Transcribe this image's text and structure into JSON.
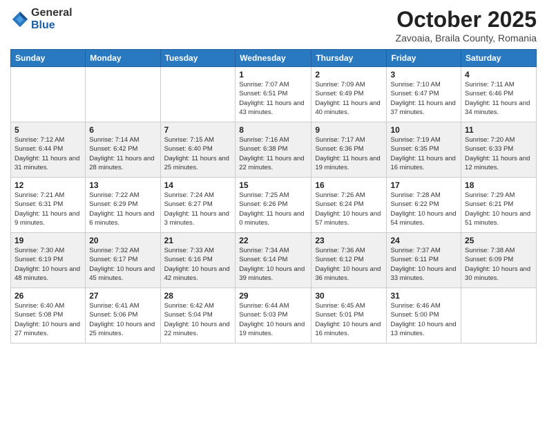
{
  "logo": {
    "general": "General",
    "blue": "Blue"
  },
  "title": "October 2025",
  "subtitle": "Zavoaia, Braila County, Romania",
  "days_of_week": [
    "Sunday",
    "Monday",
    "Tuesday",
    "Wednesday",
    "Thursday",
    "Friday",
    "Saturday"
  ],
  "weeks": [
    [
      {
        "day": "",
        "info": ""
      },
      {
        "day": "",
        "info": ""
      },
      {
        "day": "",
        "info": ""
      },
      {
        "day": "1",
        "info": "Sunrise: 7:07 AM\nSunset: 6:51 PM\nDaylight: 11 hours and 43 minutes."
      },
      {
        "day": "2",
        "info": "Sunrise: 7:09 AM\nSunset: 6:49 PM\nDaylight: 11 hours and 40 minutes."
      },
      {
        "day": "3",
        "info": "Sunrise: 7:10 AM\nSunset: 6:47 PM\nDaylight: 11 hours and 37 minutes."
      },
      {
        "day": "4",
        "info": "Sunrise: 7:11 AM\nSunset: 6:46 PM\nDaylight: 11 hours and 34 minutes."
      }
    ],
    [
      {
        "day": "5",
        "info": "Sunrise: 7:12 AM\nSunset: 6:44 PM\nDaylight: 11 hours and 31 minutes."
      },
      {
        "day": "6",
        "info": "Sunrise: 7:14 AM\nSunset: 6:42 PM\nDaylight: 11 hours and 28 minutes."
      },
      {
        "day": "7",
        "info": "Sunrise: 7:15 AM\nSunset: 6:40 PM\nDaylight: 11 hours and 25 minutes."
      },
      {
        "day": "8",
        "info": "Sunrise: 7:16 AM\nSunset: 6:38 PM\nDaylight: 11 hours and 22 minutes."
      },
      {
        "day": "9",
        "info": "Sunrise: 7:17 AM\nSunset: 6:36 PM\nDaylight: 11 hours and 19 minutes."
      },
      {
        "day": "10",
        "info": "Sunrise: 7:19 AM\nSunset: 6:35 PM\nDaylight: 11 hours and 16 minutes."
      },
      {
        "day": "11",
        "info": "Sunrise: 7:20 AM\nSunset: 6:33 PM\nDaylight: 11 hours and 12 minutes."
      }
    ],
    [
      {
        "day": "12",
        "info": "Sunrise: 7:21 AM\nSunset: 6:31 PM\nDaylight: 11 hours and 9 minutes."
      },
      {
        "day": "13",
        "info": "Sunrise: 7:22 AM\nSunset: 6:29 PM\nDaylight: 11 hours and 6 minutes."
      },
      {
        "day": "14",
        "info": "Sunrise: 7:24 AM\nSunset: 6:27 PM\nDaylight: 11 hours and 3 minutes."
      },
      {
        "day": "15",
        "info": "Sunrise: 7:25 AM\nSunset: 6:26 PM\nDaylight: 11 hours and 0 minutes."
      },
      {
        "day": "16",
        "info": "Sunrise: 7:26 AM\nSunset: 6:24 PM\nDaylight: 10 hours and 57 minutes."
      },
      {
        "day": "17",
        "info": "Sunrise: 7:28 AM\nSunset: 6:22 PM\nDaylight: 10 hours and 54 minutes."
      },
      {
        "day": "18",
        "info": "Sunrise: 7:29 AM\nSunset: 6:21 PM\nDaylight: 10 hours and 51 minutes."
      }
    ],
    [
      {
        "day": "19",
        "info": "Sunrise: 7:30 AM\nSunset: 6:19 PM\nDaylight: 10 hours and 48 minutes."
      },
      {
        "day": "20",
        "info": "Sunrise: 7:32 AM\nSunset: 6:17 PM\nDaylight: 10 hours and 45 minutes."
      },
      {
        "day": "21",
        "info": "Sunrise: 7:33 AM\nSunset: 6:16 PM\nDaylight: 10 hours and 42 minutes."
      },
      {
        "day": "22",
        "info": "Sunrise: 7:34 AM\nSunset: 6:14 PM\nDaylight: 10 hours and 39 minutes."
      },
      {
        "day": "23",
        "info": "Sunrise: 7:36 AM\nSunset: 6:12 PM\nDaylight: 10 hours and 36 minutes."
      },
      {
        "day": "24",
        "info": "Sunrise: 7:37 AM\nSunset: 6:11 PM\nDaylight: 10 hours and 33 minutes."
      },
      {
        "day": "25",
        "info": "Sunrise: 7:38 AM\nSunset: 6:09 PM\nDaylight: 10 hours and 30 minutes."
      }
    ],
    [
      {
        "day": "26",
        "info": "Sunrise: 6:40 AM\nSunset: 5:08 PM\nDaylight: 10 hours and 27 minutes."
      },
      {
        "day": "27",
        "info": "Sunrise: 6:41 AM\nSunset: 5:06 PM\nDaylight: 10 hours and 25 minutes."
      },
      {
        "day": "28",
        "info": "Sunrise: 6:42 AM\nSunset: 5:04 PM\nDaylight: 10 hours and 22 minutes."
      },
      {
        "day": "29",
        "info": "Sunrise: 6:44 AM\nSunset: 5:03 PM\nDaylight: 10 hours and 19 minutes."
      },
      {
        "day": "30",
        "info": "Sunrise: 6:45 AM\nSunset: 5:01 PM\nDaylight: 10 hours and 16 minutes."
      },
      {
        "day": "31",
        "info": "Sunrise: 6:46 AM\nSunset: 5:00 PM\nDaylight: 10 hours and 13 minutes."
      },
      {
        "day": "",
        "info": ""
      }
    ]
  ]
}
